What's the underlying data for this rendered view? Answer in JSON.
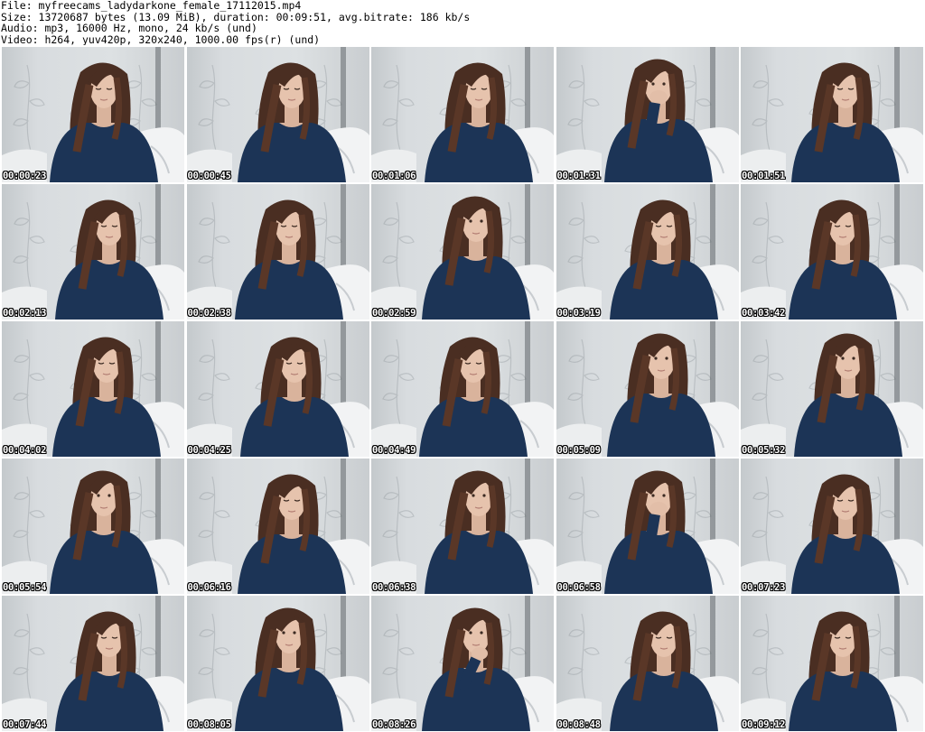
{
  "header": {
    "file_line": "File: myfreecams_ladydarkone_female_17112015.mp4",
    "size_line": "Size: 13720687 bytes (13.09 MiB), duration: 00:09:51, avg.bitrate: 186 kb/s",
    "audio_line": "Audio: mp3, 16000 Hz, mono, 24 kb/s (und)",
    "video_line": "Video: h264, yuv420p, 320x240, 1000.00 fps(r) (und)"
  },
  "thumbnails": [
    {
      "timestamp": "00:00:23",
      "pose": "down"
    },
    {
      "timestamp": "00:00:45",
      "pose": "down"
    },
    {
      "timestamp": "00:01:06",
      "pose": "down"
    },
    {
      "timestamp": "00:01:31",
      "pose": "hand-mouth"
    },
    {
      "timestamp": "00:01:51",
      "pose": "down"
    },
    {
      "timestamp": "00:02:13",
      "pose": "down"
    },
    {
      "timestamp": "00:02:38",
      "pose": "down"
    },
    {
      "timestamp": "00:02:59",
      "pose": "front"
    },
    {
      "timestamp": "00:03:19",
      "pose": "down"
    },
    {
      "timestamp": "00:03:42",
      "pose": "down"
    },
    {
      "timestamp": "00:04:02",
      "pose": "down"
    },
    {
      "timestamp": "00:04:25",
      "pose": "down"
    },
    {
      "timestamp": "00:04:49",
      "pose": "down"
    },
    {
      "timestamp": "00:05:09",
      "pose": "front"
    },
    {
      "timestamp": "00:05:32",
      "pose": "front"
    },
    {
      "timestamp": "00:05:54",
      "pose": "front"
    },
    {
      "timestamp": "00:06:16",
      "pose": "down"
    },
    {
      "timestamp": "00:06:38",
      "pose": "front"
    },
    {
      "timestamp": "00:06:58",
      "pose": "hand-mouth"
    },
    {
      "timestamp": "00:07:23",
      "pose": "down"
    },
    {
      "timestamp": "00:07:44",
      "pose": "down"
    },
    {
      "timestamp": "00:08:05",
      "pose": "front"
    },
    {
      "timestamp": "00:08:26",
      "pose": "hand-chin"
    },
    {
      "timestamp": "00:08:48",
      "pose": "down"
    },
    {
      "timestamp": "00:09:12",
      "pose": "down"
    }
  ]
}
